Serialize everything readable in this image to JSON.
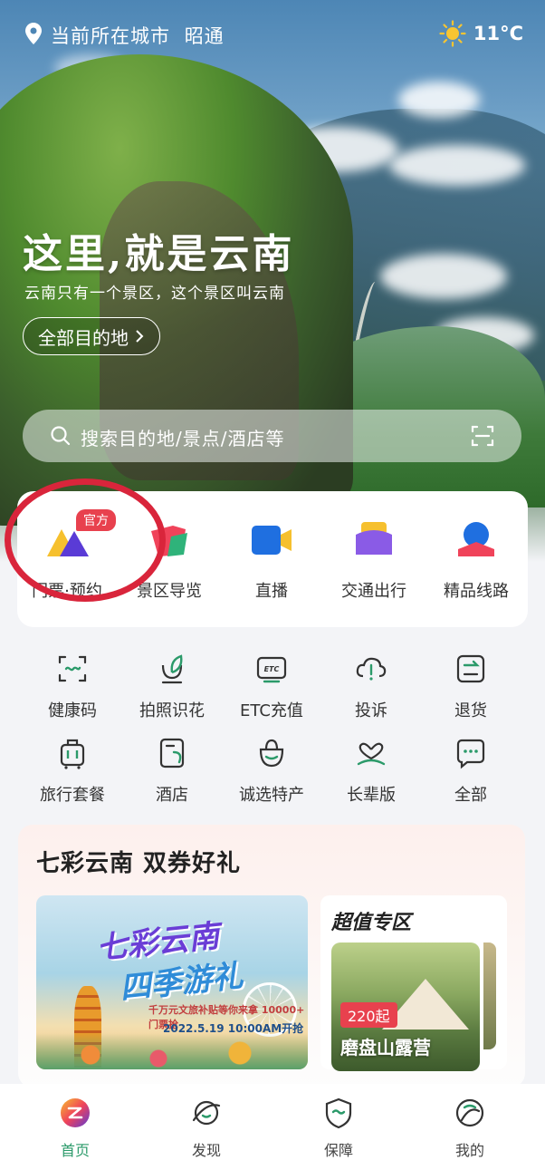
{
  "status": {
    "location_label": "当前所在城市",
    "city": "昭通",
    "temperature": "11°C",
    "weather_icon": "sun-icon"
  },
  "hero": {
    "slogan": "这里,就是云南",
    "subtitle": "云南只有一个景区，这个景区叫云南",
    "destinations_button": "全部目的地",
    "search_placeholder": "搜索目的地/景点/酒店等"
  },
  "main_services": [
    {
      "label": "门票·预约",
      "icon": "ticket-booking-icon",
      "badge": "官方"
    },
    {
      "label": "景区导览",
      "icon": "scenic-guide-icon"
    },
    {
      "label": "直播",
      "icon": "live-camera-icon"
    },
    {
      "label": "交通出行",
      "icon": "transport-icon"
    },
    {
      "label": "精品线路",
      "icon": "route-icon"
    }
  ],
  "quick_services": [
    {
      "label": "健康码",
      "icon": "health-code-icon"
    },
    {
      "label": "拍照识花",
      "icon": "flower-scan-icon"
    },
    {
      "label": "ETC充值",
      "icon": "etc-icon"
    },
    {
      "label": "投诉",
      "icon": "complaint-icon"
    },
    {
      "label": "退货",
      "icon": "return-icon"
    },
    {
      "label": "旅行套餐",
      "icon": "luggage-icon"
    },
    {
      "label": "酒店",
      "icon": "hotel-icon"
    },
    {
      "label": "诚选特产",
      "icon": "specialty-bag-icon"
    },
    {
      "label": "长辈版",
      "icon": "elder-mode-icon"
    },
    {
      "label": "全部",
      "icon": "more-icon"
    }
  ],
  "promo": {
    "title": "七彩云南 双券好礼",
    "poster_line1": "七彩云南",
    "poster_line2": "四季游礼",
    "poster_line3": "千万元文旅补贴等你来拿 10000+ 门票抢",
    "poster_line4": "2022.5.19 10:00AM开抢",
    "super_title": "超值专区",
    "camp_price": "220起",
    "camp_name": "磨盘山露营"
  },
  "bottom_nav": [
    {
      "label": "首页",
      "icon": "home-icon",
      "active": true
    },
    {
      "label": "发现",
      "icon": "discover-icon",
      "active": false
    },
    {
      "label": "保障",
      "icon": "guarantee-icon",
      "active": false
    },
    {
      "label": "我的",
      "icon": "profile-icon",
      "active": false
    }
  ],
  "colors": {
    "accent_green": "#2b9a6a",
    "badge_red": "#e8414e",
    "annotation_red": "#d9253b"
  }
}
